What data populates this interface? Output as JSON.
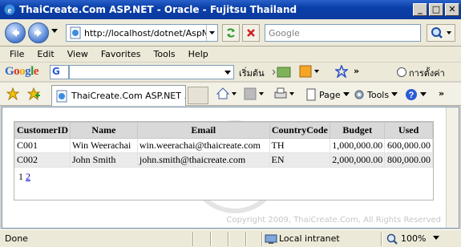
{
  "window": {
    "title": "ThaiCreate.Com ASP.NET - Oracle - Fujitsu Thailand",
    "minimize": "_",
    "maximize": "□",
    "close": "✕"
  },
  "address": {
    "url": "http://localhost/dotnet/AspNet",
    "search_placeholder": "Google"
  },
  "menu": [
    "File",
    "Edit",
    "View",
    "Favorites",
    "Tools",
    "Help"
  ],
  "google_toolbar": {
    "logo": "Google",
    "selector": "G",
    "start_label": "เริ่มต้น",
    "more": "»",
    "settings_label": "การตั้งค่า"
  },
  "command_bar": {
    "tab_title": "ThaiCreate.Com ASP.NET ...",
    "page_label": "Page",
    "tools_label": "Tools",
    "more": "»"
  },
  "grid": {
    "headers": [
      "CustomerID",
      "Name",
      "Email",
      "CountryCode",
      "Budget",
      "Used"
    ],
    "rows": [
      [
        "C001",
        "Win Weerachai",
        "win.weerachai@thaicreate.com",
        "TH",
        "1,000,000.00",
        "600,000.00"
      ],
      [
        "C002",
        "John Smith",
        "john.smith@thaicreate.com",
        "EN",
        "2,000,000.00",
        "800,000.00"
      ]
    ],
    "pager": {
      "current": "1",
      "link": "2"
    }
  },
  "content": {
    "copyright": "Copyright 2009, ThaiCreate.Com, All Rights Reserved"
  },
  "status": {
    "text": "Done",
    "zone": "Local intranet",
    "zoom": "100%"
  },
  "colors": {
    "titlebar": "#0b3aa0",
    "grid_header": "#d9d9d9",
    "grid_alt_row": "#ebebeb",
    "link": "#0000cc"
  }
}
